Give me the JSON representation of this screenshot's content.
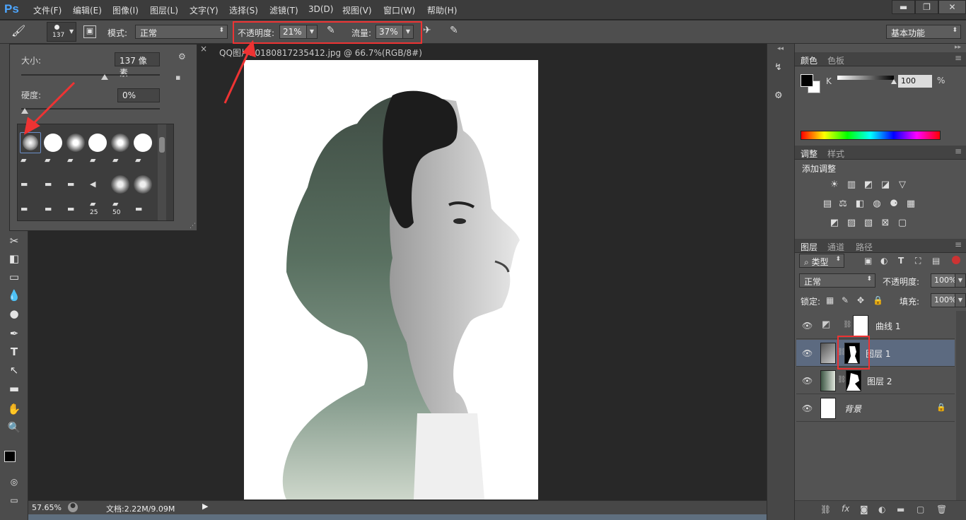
{
  "app": {
    "logo": "Ps"
  },
  "menu": [
    "文件(F)",
    "编辑(E)",
    "图像(I)",
    "图层(L)",
    "文字(Y)",
    "选择(S)",
    "滤镜(T)",
    "3D(D)",
    "视图(V)",
    "窗口(W)",
    "帮助(H)"
  ],
  "window_controls": {
    "minimize": "▬",
    "restore": "❐",
    "close": "✕"
  },
  "options": {
    "brush_size": "137",
    "mode_label": "模式:",
    "mode_value": "正常",
    "opacity_label": "不透明度:",
    "opacity_value": "21%",
    "flow_label": "流量:",
    "flow_value": "37%",
    "workspace": "基本功能"
  },
  "brush_popup": {
    "size_label": "大小:",
    "size_value": "137 像素",
    "hardness_label": "硬度:",
    "hardness_value": "0%",
    "size_fraction": 0.6,
    "hardness_fraction": 0.0,
    "brush_numbers": [
      "25",
      "50"
    ]
  },
  "document": {
    "tab_title": "QQ图片20180817235412.jpg @ 66.7%(RGB/8#)",
    "tab_close": "×"
  },
  "status": {
    "zoom": "57.65%",
    "doc_info": "文档:2.22M/9.09M"
  },
  "panels": {
    "color_tabs": [
      "颜色",
      "色板"
    ],
    "color_channel": "K",
    "color_value": "100",
    "color_unit": "%",
    "adjust_tabs": [
      "调整",
      "样式"
    ],
    "adjust_title": "添加调整",
    "layers_tabs": [
      "图层",
      "通道",
      "路径"
    ],
    "filter_type": "类型",
    "blend_mode": "正常",
    "opacity_label": "不透明度:",
    "opacity_value": "100%",
    "lock_label": "锁定:",
    "fill_label": "填充:",
    "fill_value": "100%",
    "layers": [
      {
        "name": "曲线 1"
      },
      {
        "name": "图层 1"
      },
      {
        "name": "图层 2"
      },
      {
        "name": "背景"
      }
    ],
    "footer_icons": [
      "link-icon",
      "fx-icon",
      "mask-icon",
      "adjustment-icon",
      "folder-icon",
      "new-layer-icon",
      "trash-icon"
    ]
  },
  "colors": {
    "highlight_red": "#e33333",
    "selected_layer": "#5c6a80"
  }
}
